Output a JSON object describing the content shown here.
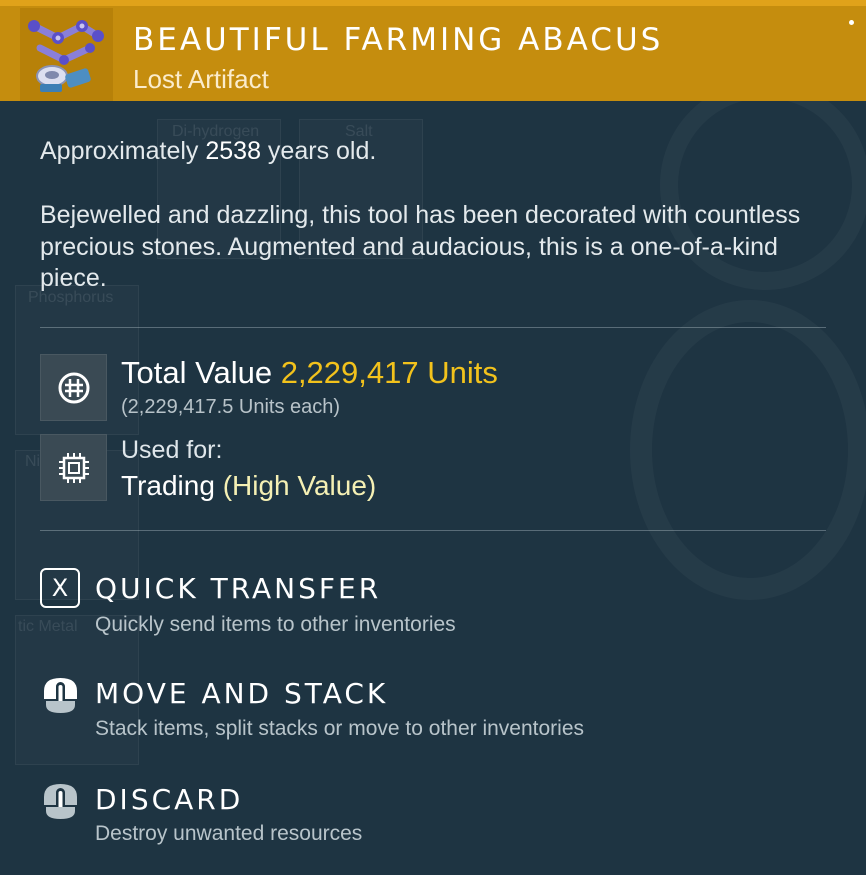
{
  "item": {
    "name": "BEAUTIFUL FARMING ABACUS",
    "category": "Lost Artifact",
    "icon": "abacus-artifact-icon",
    "header_color": "#c58d0e"
  },
  "details": {
    "age_prefix": "Approximately ",
    "age_value": "2538",
    "age_suffix": " years old.",
    "description": "Bejewelled and dazzling, this tool has been decorated with countless precious stones. Augmented and audacious, this is a one-of-a-kind piece."
  },
  "value": {
    "label": "Total Value ",
    "amount": "2,229,417 Units",
    "each": "(2,229,417.5 Units each)",
    "icon": "units-currency-icon"
  },
  "usage": {
    "label": "Used for:",
    "use": "Trading ",
    "qualifier": "(High Value)",
    "icon": "chip-icon"
  },
  "actions": [
    {
      "key": "X",
      "title": "QUICK TRANSFER",
      "description": "Quickly send items to other inventories"
    },
    {
      "icon": "mouse-right-click-icon",
      "title": "MOVE AND STACK",
      "description": "Stack items, split stacks or move to other inventories"
    },
    {
      "icon": "mouse-hold-icon",
      "title": "DISCARD",
      "description": "Destroy unwanted resources"
    }
  ],
  "background": {
    "labels": [
      "Di-hydrogen",
      "Salt",
      "Phosphorus",
      "Ni",
      "tic Metal"
    ]
  },
  "colors": {
    "accent_gold": "#f2c21c",
    "pale_yellow": "#f5f0b4",
    "panel_bg": "#1e3442"
  }
}
